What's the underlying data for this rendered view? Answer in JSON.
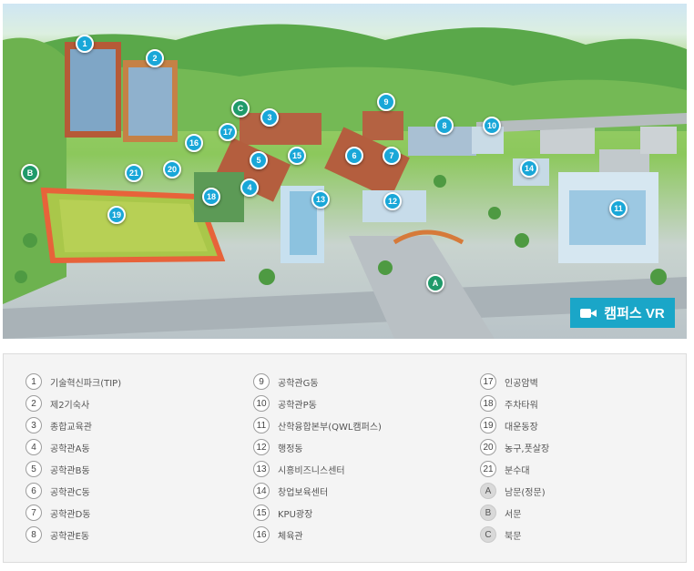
{
  "map": {
    "vr_button_label": "캠퍼스 VR",
    "markers": [
      {
        "id": "1"
      },
      {
        "id": "2"
      },
      {
        "id": "3"
      },
      {
        "id": "4"
      },
      {
        "id": "5"
      },
      {
        "id": "6"
      },
      {
        "id": "7"
      },
      {
        "id": "8"
      },
      {
        "id": "9"
      },
      {
        "id": "10"
      },
      {
        "id": "11"
      },
      {
        "id": "12"
      },
      {
        "id": "13"
      },
      {
        "id": "14"
      },
      {
        "id": "15"
      },
      {
        "id": "16"
      },
      {
        "id": "17"
      },
      {
        "id": "18"
      },
      {
        "id": "19"
      },
      {
        "id": "20"
      },
      {
        "id": "21"
      },
      {
        "id": "A"
      },
      {
        "id": "B"
      },
      {
        "id": "C"
      }
    ],
    "colors": {
      "marker": "#19a7d8",
      "gate_marker": "#1f9a6a",
      "vr_button": "#1aa6c8"
    }
  },
  "legend": {
    "columns": [
      [
        {
          "num": "1",
          "label": "기술혁신파크(TIP)"
        },
        {
          "num": "2",
          "label": "제2기숙사"
        },
        {
          "num": "3",
          "label": "종합교육관"
        },
        {
          "num": "4",
          "label": "공학관A동"
        },
        {
          "num": "5",
          "label": "공학관B동"
        },
        {
          "num": "6",
          "label": "공학관C동"
        },
        {
          "num": "7",
          "label": "공학관D동"
        },
        {
          "num": "8",
          "label": "공학관E동"
        }
      ],
      [
        {
          "num": "9",
          "label": "공학관G동"
        },
        {
          "num": "10",
          "label": "공학관P동"
        },
        {
          "num": "11",
          "label": "산학융합본부(QWL캠퍼스)"
        },
        {
          "num": "12",
          "label": "행정동"
        },
        {
          "num": "13",
          "label": "시흥비즈니스센터"
        },
        {
          "num": "14",
          "label": "창업보육센터"
        },
        {
          "num": "15",
          "label": "KPU광장"
        },
        {
          "num": "16",
          "label": "체육관"
        }
      ],
      [
        {
          "num": "17",
          "label": "인공암벽"
        },
        {
          "num": "18",
          "label": "주차타워"
        },
        {
          "num": "19",
          "label": "대운동장"
        },
        {
          "num": "20",
          "label": "농구,풋살장"
        },
        {
          "num": "21",
          "label": "분수대"
        },
        {
          "num": "A",
          "label": "남문(정문)"
        },
        {
          "num": "B",
          "label": "서문"
        },
        {
          "num": "C",
          "label": "북문"
        }
      ]
    ]
  }
}
